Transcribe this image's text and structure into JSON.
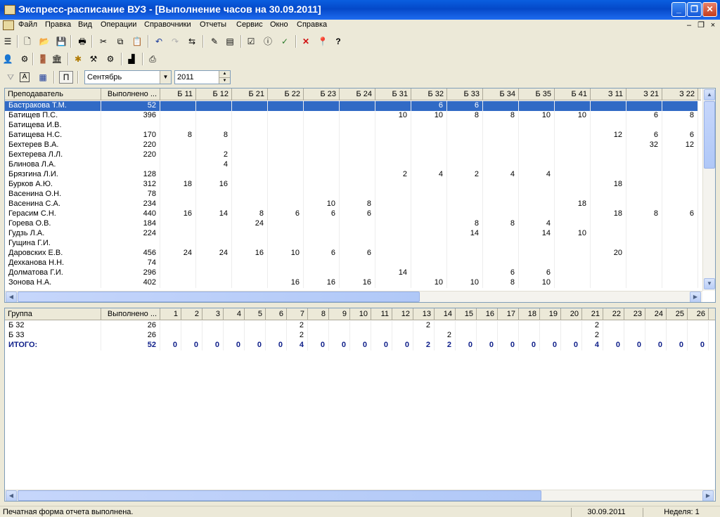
{
  "window": {
    "title": "Экспресс-расписание ВУЗ - [Выполнение часов на 30.09.2011]",
    "buttons": {
      "minimize": "_",
      "restore": "❐",
      "close": "✕"
    }
  },
  "menu": [
    "Файл",
    "Правка",
    "Вид",
    "Операции",
    "Справочники",
    "Отчеты",
    "Сервис",
    "Окно",
    "Справка"
  ],
  "mdi_buttons": {
    "minimize": "–",
    "restore": "❐",
    "close": "×"
  },
  "toolbar1": [
    {
      "icon": "list-icon",
      "glyph": "☰"
    },
    {
      "icon": "new-icon",
      "glyph": "🗋"
    },
    {
      "icon": "open-icon",
      "glyph": "📂"
    },
    {
      "icon": "save-icon",
      "glyph": "💾"
    },
    {
      "icon": "print-icon",
      "glyph": "🖶"
    },
    {
      "icon": "cut-icon",
      "glyph": "✂"
    },
    {
      "icon": "copy-icon",
      "glyph": "⧉"
    },
    {
      "icon": "paste-icon",
      "glyph": "📋"
    },
    {
      "icon": "undo-icon",
      "glyph": "↶"
    },
    {
      "icon": "redo-icon",
      "glyph": "↷"
    },
    {
      "icon": "replace-icon",
      "glyph": "⇆"
    },
    {
      "icon": "edit-icon",
      "glyph": "✎"
    },
    {
      "icon": "report-icon",
      "glyph": "▤"
    },
    {
      "icon": "check-icon",
      "glyph": "☑"
    },
    {
      "icon": "info-icon",
      "glyph": "ⓘ"
    },
    {
      "icon": "filter-check-icon",
      "glyph": "✓"
    },
    {
      "icon": "delete-icon",
      "glyph": "✕"
    },
    {
      "icon": "pin-icon",
      "glyph": "📍"
    },
    {
      "icon": "help-icon",
      "glyph": "?"
    }
  ],
  "toolbar2": [
    {
      "icon": "teacher-icon",
      "glyph": "👤"
    },
    {
      "icon": "bike-icon",
      "glyph": "⚙"
    },
    {
      "icon": "door-icon",
      "glyph": "🚪"
    },
    {
      "icon": "building-icon",
      "glyph": "🏛"
    },
    {
      "icon": "wizard-icon",
      "glyph": "✱"
    },
    {
      "icon": "tools-icon",
      "glyph": "⚒"
    },
    {
      "icon": "settings-icon",
      "glyph": "⚙"
    },
    {
      "icon": "stamp-icon",
      "glyph": "▟"
    },
    {
      "icon": "export-icon",
      "glyph": "⎙"
    }
  ],
  "toolbar3": {
    "filter_icon": "⛛",
    "text_icon": "A",
    "calendar_icon": "▦",
    "p_button": "П",
    "month": "Сентябрь",
    "year": "2011"
  },
  "top_grid": {
    "headers": [
      "Преподаватель",
      "Выполнено ...",
      "Б 11",
      "Б 12",
      "Б 21",
      "Б 22",
      "Б 23",
      "Б 24",
      "Б 31",
      "Б 32",
      "Б 33",
      "Б 34",
      "Б 35",
      "Б 41",
      "З 11",
      "З 21",
      "З 22"
    ],
    "rows": [
      [
        "Бастракова Т.М.",
        "52",
        "",
        "",
        "",
        "",
        "",
        "",
        "",
        "6",
        "6",
        "",
        "",
        "",
        "",
        "",
        ""
      ],
      [
        "Батищев П.С.",
        "396",
        "",
        "",
        "",
        "",
        "",
        "",
        "10",
        "10",
        "8",
        "8",
        "10",
        "10",
        "",
        "6",
        "8"
      ],
      [
        "Батищева И.В.",
        "",
        "",
        "",
        "",
        "",
        "",
        "",
        "",
        "",
        "",
        "",
        "",
        "",
        "",
        "",
        ""
      ],
      [
        "Батищева Н.С.",
        "170",
        "8",
        "8",
        "",
        "",
        "",
        "",
        "",
        "",
        "",
        "",
        "",
        "",
        "12",
        "6",
        "6"
      ],
      [
        "Бехтерев В.А.",
        "220",
        "",
        "",
        "",
        "",
        "",
        "",
        "",
        "",
        "",
        "",
        "",
        "",
        "",
        "32",
        "12"
      ],
      [
        "Бехтерева Л.Л.",
        "220",
        "",
        "2",
        "",
        "",
        "",
        "",
        "",
        "",
        "",
        "",
        "",
        "",
        "",
        "",
        ""
      ],
      [
        "Блинова Л.А.",
        "",
        "",
        "4",
        "",
        "",
        "",
        "",
        "",
        "",
        "",
        "",
        "",
        "",
        "",
        "",
        ""
      ],
      [
        "Брязгина Л.И.",
        "128",
        "",
        "",
        "",
        "",
        "",
        "",
        "2",
        "4",
        "2",
        "4",
        "4",
        "",
        "",
        "",
        ""
      ],
      [
        "Бурков А.Ю.",
        "312",
        "18",
        "16",
        "",
        "",
        "",
        "",
        "",
        "",
        "",
        "",
        "",
        "",
        "18",
        "",
        ""
      ],
      [
        "Васенина О.Н.",
        "78",
        "",
        "",
        "",
        "",
        "",
        "",
        "",
        "",
        "",
        "",
        "",
        "",
        "",
        "",
        ""
      ],
      [
        "Васенина С.А.",
        "234",
        "",
        "",
        "",
        "",
        "10",
        "8",
        "",
        "",
        "",
        "",
        "",
        "18",
        "",
        "",
        ""
      ],
      [
        "Герасим С.Н.",
        "440",
        "16",
        "14",
        "8",
        "6",
        "6",
        "6",
        "",
        "",
        "",
        "",
        "",
        "",
        "18",
        "8",
        "6"
      ],
      [
        "Горева О.В.",
        "184",
        "",
        "",
        "24",
        "",
        "",
        "",
        "",
        "",
        "8",
        "8",
        "4",
        "",
        "",
        "",
        ""
      ],
      [
        "Гудзь Л.А.",
        "224",
        "",
        "",
        "",
        "",
        "",
        "",
        "",
        "",
        "14",
        "",
        "14",
        "10",
        "",
        "",
        ""
      ],
      [
        "Гущина Г.И.",
        "",
        "",
        "",
        "",
        "",
        "",
        "",
        "",
        "",
        "",
        "",
        "",
        "",
        "",
        "",
        ""
      ],
      [
        "Даровских Е.В.",
        "456",
        "24",
        "24",
        "16",
        "10",
        "6",
        "6",
        "",
        "",
        "",
        "",
        "",
        "",
        "20",
        "",
        ""
      ],
      [
        "Дехканова Н.Н.",
        "74",
        "",
        "",
        "",
        "",
        "",
        "",
        "",
        "",
        "",
        "",
        "",
        "",
        "",
        "",
        ""
      ],
      [
        "Долматова Г.И.",
        "296",
        "",
        "",
        "",
        "",
        "",
        "",
        "14",
        "",
        "",
        "6",
        "6",
        "",
        "",
        "",
        ""
      ],
      [
        "Зонова Н.А.",
        "402",
        "",
        "",
        "",
        "16",
        "16",
        "16",
        "",
        "10",
        "10",
        "8",
        "10",
        "",
        "",
        "",
        ""
      ]
    ]
  },
  "bottom_grid": {
    "headers": [
      "Группа",
      "Выполнено ...",
      "1",
      "2",
      "3",
      "4",
      "5",
      "6",
      "7",
      "8",
      "9",
      "10",
      "11",
      "12",
      "13",
      "14",
      "15",
      "16",
      "17",
      "18",
      "19",
      "20",
      "21",
      "22",
      "23",
      "24",
      "25",
      "26"
    ],
    "rows": [
      [
        "Б 32",
        "26",
        "",
        "",
        "",
        "",
        "",
        "",
        "2",
        "",
        "",
        "",
        "",
        "",
        "2",
        "",
        "",
        "",
        "",
        "",
        "",
        "",
        "2",
        "",
        "",
        "",
        "",
        ""
      ],
      [
        "Б 33",
        "26",
        "",
        "",
        "",
        "",
        "",
        "",
        "2",
        "",
        "",
        "",
        "",
        "",
        "",
        "2",
        "",
        "",
        "",
        "",
        "",
        "",
        "2",
        "",
        "",
        "",
        "",
        ""
      ]
    ],
    "total": [
      "ИТОГО:",
      "52",
      "0",
      "0",
      "0",
      "0",
      "0",
      "0",
      "4",
      "0",
      "0",
      "0",
      "0",
      "0",
      "2",
      "2",
      "0",
      "0",
      "0",
      "0",
      "0",
      "0",
      "4",
      "0",
      "0",
      "0",
      "0",
      "0"
    ]
  },
  "statusbar": {
    "message": "Печатная форма отчета выполнена.",
    "date": "30.09.2011",
    "week": "Неделя: 1"
  },
  "colors": {
    "selection": "#316ac5",
    "total_text": "#10208a",
    "titlebar": "#0a5fe0"
  }
}
